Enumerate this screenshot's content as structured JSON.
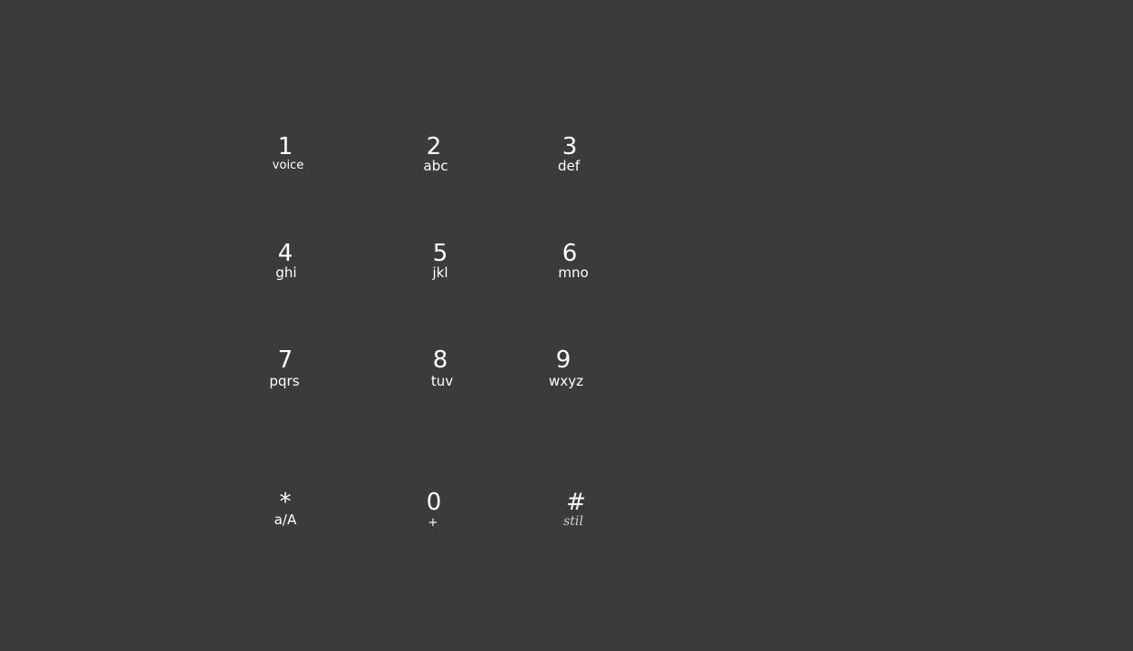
{
  "keypad": {
    "keys": [
      {
        "digit": "1",
        "sub": "voice"
      },
      {
        "digit": "2",
        "sub": "abc"
      },
      {
        "digit": "3",
        "sub": "def"
      },
      {
        "digit": "4",
        "sub": "ghi"
      },
      {
        "digit": "5",
        "sub": "jkl"
      },
      {
        "digit": "6",
        "sub": "mno"
      },
      {
        "digit": "7",
        "sub": "pqrs"
      },
      {
        "digit": "8",
        "sub": "tuv"
      },
      {
        "digit": "9",
        "sub": "wxyz"
      },
      {
        "digit": "*",
        "sub": "a/A"
      },
      {
        "digit": "0",
        "sub": "+"
      },
      {
        "digit": "#",
        "sub": "stil"
      }
    ]
  },
  "colors": {
    "background": "#3b3b3b",
    "text": "#ffffff",
    "faint_text": "#cfcfcf"
  }
}
